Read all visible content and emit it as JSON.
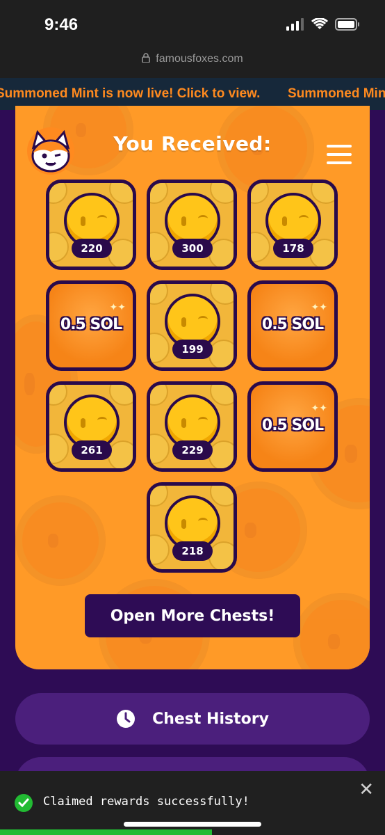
{
  "status_bar": {
    "time": "9:46",
    "url": "famousfoxes.com"
  },
  "ticker": {
    "text": "Summoned Mint is now live! Click to view."
  },
  "card": {
    "title": "You Received:"
  },
  "rewards": [
    {
      "type": "coin",
      "value": "220"
    },
    {
      "type": "coin",
      "value": "300"
    },
    {
      "type": "coin",
      "value": "178"
    },
    {
      "type": "sol",
      "value": "0.5 SOL"
    },
    {
      "type": "coin",
      "value": "199"
    },
    {
      "type": "sol",
      "value": "0.5 SOL"
    },
    {
      "type": "coin",
      "value": "261"
    },
    {
      "type": "coin",
      "value": "229"
    },
    {
      "type": "sol",
      "value": "0.5 SOL"
    },
    {
      "type": "coin",
      "value": "218"
    }
  ],
  "actions": {
    "open_more": "Open More Chests!",
    "chest_history": "Chest History"
  },
  "toast": {
    "message": "Claimed rewards successfully!",
    "progress": 0.55
  },
  "colors": {
    "brand_purple": "#2e0c55",
    "card_orange": "#ff9a27",
    "ticker_text": "#ff8a1f",
    "success": "#22bb33"
  },
  "icons": [
    "signal-icon",
    "wifi-icon",
    "battery-icon",
    "lock-icon",
    "fox-logo-icon",
    "menu-icon",
    "clock-icon",
    "check-circle-icon",
    "close-icon"
  ]
}
